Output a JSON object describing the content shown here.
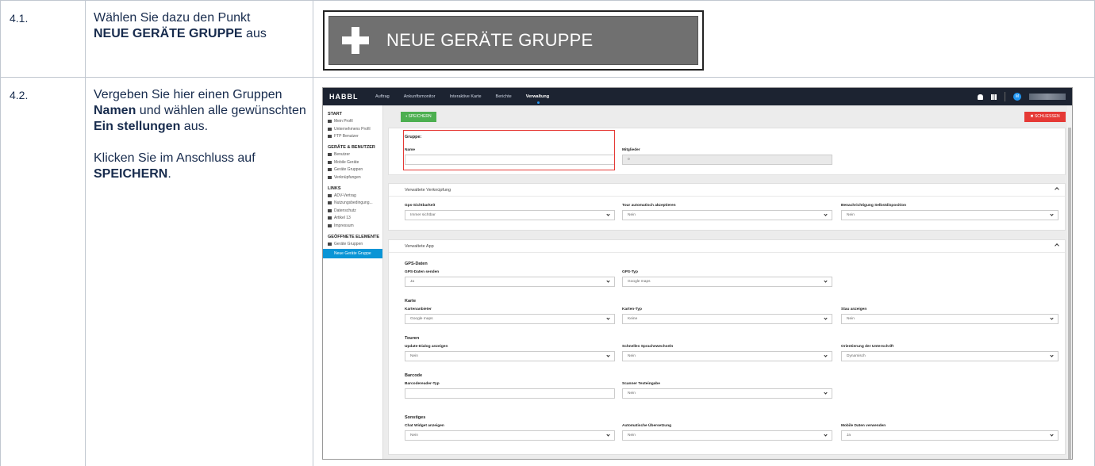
{
  "rows": [
    {
      "number": "4.1.",
      "desc": {
        "line1": "Wählen Sie dazu den Punkt",
        "bold1": "NEUE GERÄTE GRUPPE",
        "rest1": " aus"
      },
      "button_label": "NEUE GERÄTE GRUPPE"
    },
    {
      "number": "4.2.",
      "desc": {
        "p1_a": "Vergeben Sie hier einen Gruppen ",
        "p1_b": "Namen",
        "p1_c": " und wählen alle gewünschten ",
        "p1_d": "Ein stellungen",
        "p1_e": " aus.",
        "p2_a": "Klicken Sie im Anschluss auf ",
        "p2_b": "SPEICHERN",
        "p2_c": "."
      }
    }
  ],
  "app": {
    "logo": "HABBL",
    "nav": [
      "Auftrag",
      "Ankunftsmonitor",
      "Interaktive Karte",
      "Berichte",
      "Verwaltung"
    ],
    "user_initial": "M",
    "sidebar": {
      "start_head": "START",
      "start_items": [
        "Mein Profil",
        "Unternehmens Profil",
        "FTP Benutzer"
      ],
      "devices_head": "GERÄTE & BENUTZER",
      "devices_items": [
        "Benutzer",
        "Mobile Geräte",
        "Geräte Gruppen",
        "Verknüpfungen"
      ],
      "links_head": "LINKS",
      "links_items": [
        "ADV-Vertrag",
        "Nutzungsbedingung...",
        "Datenschutz",
        "Artikel 13",
        "Impressum"
      ],
      "open_head": "GEÖFFNETE ELEMENTE",
      "open_items": [
        "Geräte Gruppen"
      ],
      "active_item": "Neue Geräte Gruppe"
    },
    "save_label": "SPEICHERN",
    "close_label": "SCHLIESSEN",
    "group": {
      "title": "Gruppe:",
      "name_label": "Name",
      "name_value": "",
      "members_label": "Mitglieder",
      "members_value": "0"
    },
    "links_panel": {
      "title": "Verwaltete Verknüpfung",
      "f1_label": "Gps-Sichtbarkeit",
      "f1_value": "Immer sichtbar",
      "f2_label": "Tour automatisch akzeptieren",
      "f2_value": "Nein",
      "f3_label": "Benachrichtigung Selbstdisposition",
      "f3_value": "Nein"
    },
    "app_panel": {
      "title": "Verwaltete App",
      "gps_head": "GPS-Daten",
      "gps_send_label": "GPS-Daten senden",
      "gps_send_value": "Ja",
      "gps_type_label": "GPS-Typ",
      "gps_type_value": "Google maps",
      "map_head": "Karte",
      "map_provider_label": "Kartenanbieter",
      "map_provider_value": "Google maps",
      "map_type_label": "Karten-Typ",
      "map_type_value": "Keine",
      "traffic_label": "Stau anzeigen",
      "traffic_value": "Nein",
      "tours_head": "Touren",
      "update_label": "Update-Dialog anzeigen",
      "update_value": "Nein",
      "lang_label": "Schnelles Sprachewechseln",
      "lang_value": "Nein",
      "sign_label": "Orientierung der Unterschrift",
      "sign_value": "Dynamisch",
      "barcode_head": "Barcode",
      "reader_label": "Barcodereader-Typ",
      "reader_value": "",
      "scanner_label": "Scanner Texteingabe",
      "scanner_value": "Nein",
      "misc_head": "Sonstiges",
      "chat_label": "Chat Widget anzeigen",
      "chat_value": "Nein",
      "translate_label": "Automatische Übersetzung",
      "translate_value": "Nein",
      "mobile_label": "Mobile Daten verwenden",
      "mobile_value": "Ja"
    }
  }
}
